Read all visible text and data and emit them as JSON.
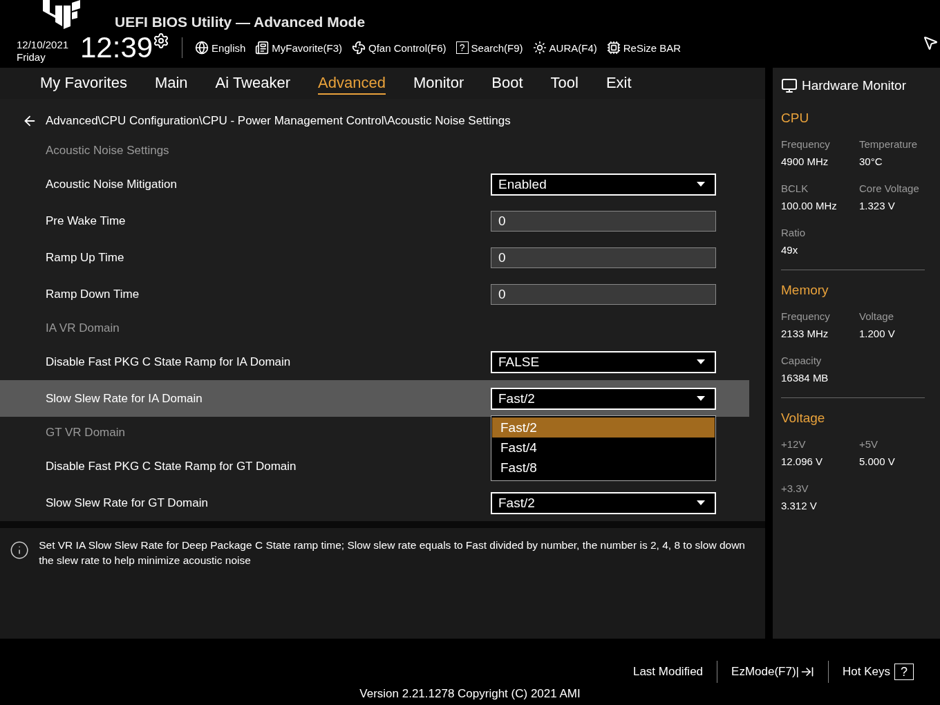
{
  "header": {
    "title": "UEFI BIOS Utility — Advanced Mode",
    "date": "12/10/2021",
    "day": "Friday",
    "time": "12:39",
    "tools": [
      {
        "kind": "globe",
        "label": "English"
      },
      {
        "kind": "favorite",
        "label": "MyFavorite(F3)"
      },
      {
        "kind": "fan",
        "label": "Qfan Control(F6)"
      },
      {
        "kind": "help",
        "glyph": "?",
        "label": "Search(F9)"
      },
      {
        "kind": "aura",
        "label": "AURA(F4)"
      },
      {
        "kind": "bar",
        "label": "ReSize BAR"
      }
    ]
  },
  "tabs": [
    {
      "label": "My Favorites",
      "selected": false
    },
    {
      "label": "Main",
      "selected": false
    },
    {
      "label": "Ai Tweaker",
      "selected": false
    },
    {
      "label": "Advanced",
      "selected": true
    },
    {
      "label": "Monitor",
      "selected": false
    },
    {
      "label": "Boot",
      "selected": false
    },
    {
      "label": "Tool",
      "selected": false
    },
    {
      "label": "Exit",
      "selected": false
    }
  ],
  "breadcrumb": "Advanced\\CPU Configuration\\CPU - Power Management Control\\Acoustic Noise Settings",
  "settings": [
    {
      "kind": "section",
      "label": "Acoustic Noise Settings"
    },
    {
      "kind": "dropdown",
      "label": "Acoustic Noise Mitigation",
      "value": "Enabled",
      "selected": false
    },
    {
      "kind": "input",
      "label": "Pre Wake Time",
      "value": "0",
      "selected": false
    },
    {
      "kind": "input",
      "label": "Ramp Up Time",
      "value": "0",
      "selected": false
    },
    {
      "kind": "input",
      "label": "Ramp Down Time",
      "value": "0",
      "selected": false
    },
    {
      "kind": "section",
      "label": "IA VR Domain"
    },
    {
      "kind": "dropdown",
      "label": "Disable Fast PKG C State Ramp for IA Domain",
      "value": "FALSE",
      "selected": false
    },
    {
      "kind": "dropdown",
      "label": "Slow Slew Rate for IA Domain",
      "value": "Fast/2",
      "selected": true,
      "expanded": true,
      "options": [
        {
          "label": "Fast/2",
          "selected": true
        },
        {
          "label": "Fast/4",
          "selected": false
        },
        {
          "label": "Fast/8",
          "selected": false
        }
      ]
    },
    {
      "kind": "section",
      "label": "GT VR Domain"
    },
    {
      "kind": "label",
      "label": "Disable Fast PKG C State Ramp for GT Domain",
      "selected": false
    },
    {
      "kind": "dropdown",
      "label": "Slow Slew Rate for GT Domain",
      "value": "Fast/2",
      "selected": false
    }
  ],
  "help_text": "Set VR IA Slow Slew Rate for Deep Package C State ramp time; Slow slew rate equals to Fast divided by number, the number is 2, 4, 8 to slow down the slew rate to help minimize acoustic noise",
  "hardware_monitor": {
    "title": "Hardware Monitor",
    "groups": [
      {
        "title": "CPU",
        "fields": [
          {
            "label": "Frequency",
            "value": "4900 MHz"
          },
          {
            "label": "Temperature",
            "value": "30°C"
          },
          {
            "label": "BCLK",
            "value": "100.00 MHz"
          },
          {
            "label": "Core Voltage",
            "value": "1.323 V"
          },
          {
            "label": "Ratio",
            "value": "49x"
          }
        ]
      },
      {
        "title": "Memory",
        "fields": [
          {
            "label": "Frequency",
            "value": "2133 MHz"
          },
          {
            "label": "Voltage",
            "value": "1.200 V"
          },
          {
            "label": "Capacity",
            "value": "16384 MB"
          }
        ]
      },
      {
        "title": "Voltage",
        "fields": [
          {
            "label": "+12V",
            "value": "12.096 V"
          },
          {
            "label": "+5V",
            "value": "5.000 V"
          },
          {
            "label": "+3.3V",
            "value": "3.312 V"
          }
        ]
      }
    ]
  },
  "footer": {
    "buttons": [
      {
        "kind": "plain",
        "label": "Last Modified"
      },
      {
        "kind": "exit",
        "label": "EzMode(F7)|"
      },
      {
        "kind": "help",
        "label": "Hot Keys",
        "glyph": "?"
      }
    ],
    "version": "Version 2.21.1278 Copyright (C) 2021 AMI"
  }
}
